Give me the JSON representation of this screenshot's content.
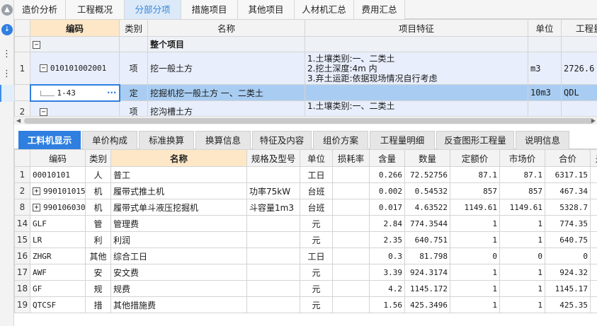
{
  "top_tabs": [
    {
      "label": "造价分析",
      "active": false
    },
    {
      "label": "工程概况",
      "active": false
    },
    {
      "label": "分部分项",
      "active": true
    },
    {
      "label": "措施项目",
      "active": false
    },
    {
      "label": "其他项目",
      "active": false
    },
    {
      "label": "人材机汇总",
      "active": false
    },
    {
      "label": "费用汇总",
      "active": false
    }
  ],
  "upper_grid": {
    "headers": {
      "code": "编码",
      "type": "类别",
      "name": "名称",
      "feature": "项目特征",
      "unit": "单位",
      "qty": "工程量"
    },
    "section_row": {
      "toggle": "−",
      "name": "整个项目"
    },
    "qd_row": {
      "index": "1",
      "toggle": "−",
      "code": "010101002001",
      "type": "项",
      "name": "挖一般土方",
      "features": [
        "1.土壤类别:一、二类土",
        "2.挖土深度:4m 内",
        "3.弃土运距:依据现场情况自行考虑"
      ],
      "unit": "m3",
      "qty": "2726.6"
    },
    "de_row": {
      "code": "1-43",
      "more": "···",
      "type": "定",
      "name": "挖掘机挖一般土方 一、二类土",
      "unit": "10m3",
      "qty": "QDL"
    },
    "next_row": {
      "index": "2",
      "toggle": "−",
      "type": "项",
      "name": "挖沟槽土方",
      "features": [
        "1.土壤类别:一、二类土"
      ]
    }
  },
  "bottom_tabs": [
    {
      "label": "工料机显示",
      "active": true
    },
    {
      "label": "单价构成",
      "active": false
    },
    {
      "label": "标准换算",
      "active": false
    },
    {
      "label": "换算信息",
      "active": false
    },
    {
      "label": "特征及内容",
      "active": false
    },
    {
      "label": "组价方案",
      "active": false
    },
    {
      "label": "工程量明细",
      "active": false
    },
    {
      "label": "反查图形工程量",
      "active": false
    },
    {
      "label": "说明信息",
      "active": false
    }
  ],
  "lower_grid": {
    "headers": [
      "编码",
      "类别",
      "名称",
      "规格及型号",
      "单位",
      "损耗率",
      "含量",
      "数量",
      "定额价",
      "市场价",
      "合价",
      "是"
    ],
    "rows": [
      {
        "index": "1",
        "expand": "",
        "code": "00010101",
        "type": "人",
        "name": "普工",
        "spec": "",
        "unit": "工日",
        "loss": "",
        "content": "0.266",
        "qty": "72.52756",
        "quota": "87.1",
        "market": "87.1",
        "total": "6317.15"
      },
      {
        "index": "2",
        "expand": "+",
        "code": "990101015",
        "type": "机",
        "name": "履带式推土机",
        "spec": "功率75kW",
        "unit": "台班",
        "loss": "",
        "content": "0.002",
        "qty": "0.54532",
        "quota": "857",
        "market": "857",
        "total": "467.34"
      },
      {
        "index": "8",
        "expand": "+",
        "code": "990106030",
        "type": "机",
        "name": "履带式单斗液压挖掘机",
        "spec": "斗容量1m3",
        "unit": "台班",
        "loss": "",
        "content": "0.017",
        "qty": "4.63522",
        "quota": "1149.61",
        "market": "1149.61",
        "total": "5328.7"
      },
      {
        "index": "14",
        "expand": "",
        "code": "GLF",
        "type": "管",
        "name": "管理费",
        "spec": "",
        "unit": "元",
        "loss": "",
        "content": "2.84",
        "qty": "774.3544",
        "quota": "1",
        "market": "1",
        "total": "774.35"
      },
      {
        "index": "15",
        "expand": "",
        "code": "LR",
        "type": "利",
        "name": "利润",
        "spec": "",
        "unit": "元",
        "loss": "",
        "content": "2.35",
        "qty": "640.751",
        "quota": "1",
        "market": "1",
        "total": "640.75"
      },
      {
        "index": "16",
        "expand": "",
        "code": "ZHGR",
        "type": "其他",
        "name": "综合工日",
        "spec": "",
        "unit": "工日",
        "loss": "",
        "content": "0.3",
        "qty": "81.798",
        "quota": "0",
        "market": "0",
        "total": "0"
      },
      {
        "index": "17",
        "expand": "",
        "code": "AWF",
        "type": "安",
        "name": "安文费",
        "spec": "",
        "unit": "元",
        "loss": "",
        "content": "3.39",
        "qty": "924.3174",
        "quota": "1",
        "market": "1",
        "total": "924.32"
      },
      {
        "index": "18",
        "expand": "",
        "code": "GF",
        "type": "规",
        "name": "规费",
        "spec": "",
        "unit": "元",
        "loss": "",
        "content": "4.2",
        "qty": "1145.172",
        "quota": "1",
        "market": "1",
        "total": "1145.17"
      },
      {
        "index": "19",
        "expand": "",
        "code": "QTCSF",
        "type": "措",
        "name": "其他措施费",
        "spec": "",
        "unit": "元",
        "loss": "",
        "content": "1.56",
        "qty": "425.3496",
        "quota": "1",
        "market": "1",
        "total": "425.35"
      }
    ]
  },
  "icons": {
    "collapse": "chevron-up-icon",
    "download": "download-icon",
    "more": "more-icon"
  },
  "colors": {
    "accent": "#2f7fe0",
    "selected_row": "#a9cdf2",
    "header_highlight": "#fde7c6"
  }
}
